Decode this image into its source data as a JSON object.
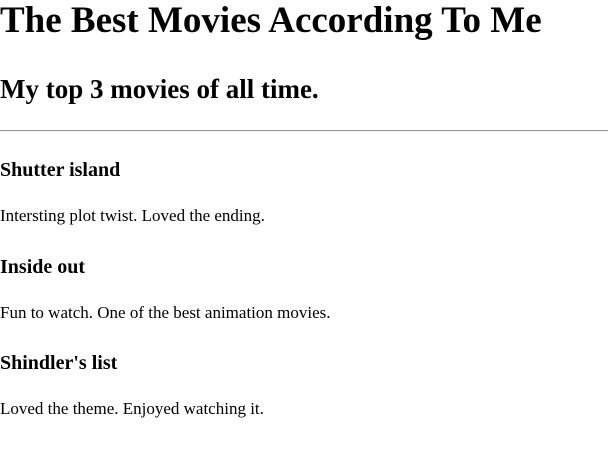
{
  "header": {
    "title": "The Best Movies According To Me",
    "subtitle": "My top 3 movies of all time."
  },
  "movies": [
    {
      "title": "Shutter island",
      "review": "Intersting plot twist. Loved the ending."
    },
    {
      "title": "Inside out",
      "review": "Fun to watch. One of the best animation movies."
    },
    {
      "title": "Shindler's list",
      "review": "Loved the theme. Enjoyed watching it."
    }
  ]
}
